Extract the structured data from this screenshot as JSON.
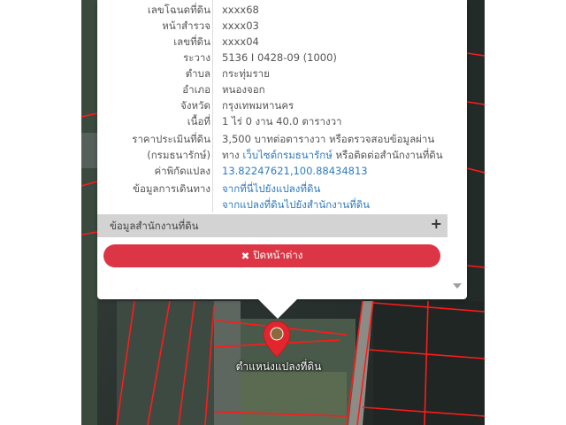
{
  "popup": {
    "rows": [
      {
        "label": "เลขโฉนดที่ดิน",
        "value": "xxxx68"
      },
      {
        "label": "หน้าสำรวจ",
        "value": "xxxx03"
      },
      {
        "label": "เลขที่ดิน",
        "value": "xxxx04"
      },
      {
        "label": "ระวาง",
        "value": "5136 I 0428-09 (1000)"
      },
      {
        "label": "ตำบล",
        "value": "กระทุ่มราย"
      },
      {
        "label": "อำเภอ",
        "value": "หนองจอก"
      },
      {
        "label": "จังหวัด",
        "value": "กรุงเทพมหานคร"
      },
      {
        "label": "เนื้อที่",
        "value": "1 ไร่ 0 งาน 40.0 ตารางวา"
      }
    ],
    "price": {
      "label_line1": "ราคาประเมินที่ดิน",
      "label_line2": "(กรมธนารักษ์)",
      "value_line1": "3,500 บาทต่อตารางวา หรือตรวจสอบข้อมูลผ่าน",
      "value_prefix": "ทาง",
      "link_text": "เว็บไซต์กรมธนารักษ์",
      "value_suffix": "หรือติดต่อสำนักงานที่ดิน"
    },
    "coords": {
      "label": "ค่าพิกัดแปลง",
      "value": "13.82247621,100.88434813"
    },
    "travel": {
      "label": "ข้อมูลการเดินทาง",
      "link1": "จากที่นี่ไปยังแปลงที่ดิน",
      "link2": "จากแปลงที่ดินไปยังสำนักงานที่ดิน"
    },
    "office_section": "ข้อมูลสำนักงานที่ดิน",
    "expand_symbol": "+",
    "close_label": "ปิดหน้าต่าง"
  },
  "map": {
    "marker_label": "ตำแหน่งแปลงที่ดิน",
    "parcel_line_color": "#ff1a1a",
    "marker_color": "#e3262e"
  }
}
